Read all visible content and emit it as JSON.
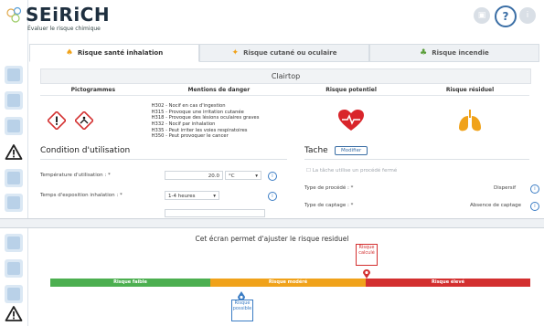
{
  "header": {
    "brand": "SEiRiCH",
    "tagline": "Évaluer le risque chimique",
    "help_label": "?",
    "colors": {
      "brand": "#1e2f3f",
      "accent": "#3a6ea5"
    }
  },
  "tabs": [
    {
      "label": "Risque santé inhalation",
      "icon": "lungs-icon",
      "active": true
    },
    {
      "label": "Risque cutané ou oculaire",
      "icon": "drops-icon",
      "active": false
    },
    {
      "label": "Risque incendie",
      "icon": "plant-icon",
      "active": false
    }
  ],
  "product": {
    "name": "Clairtop"
  },
  "table": {
    "headers": [
      "Pictogrammes",
      "Mentions de danger",
      "Risque potentiel",
      "Risque résiduel"
    ],
    "pictograms": [
      "exclamation-pictogram",
      "health-hazard-pictogram"
    ],
    "hazard_statements": [
      "H302 - Nocif en cas d'ingestion",
      "H315 - Provoque une irritation cutanée",
      "H318 - Provoque des lésions oculaires graves",
      "H332 - Nocif par inhalation",
      "H335 - Peut irriter les voies respiratoires",
      "H350 - Peut provoquer le cancer"
    ],
    "potential_risk_icon": "heart-icon",
    "residual_risk_icon": "lungs-icon"
  },
  "conditions": {
    "title": "Condition d'utilisation",
    "temperature_label": "Température d'utilisation : *",
    "temperature_value": "20.0",
    "temperature_unit": "°C",
    "exposure_label": "Temps d'exposition inhalation : *",
    "exposure_value": "1-4 heures"
  },
  "task": {
    "title": "Tache",
    "modify_label": "Modifier",
    "checkbox_label": "La tâche utilise un procédé fermé",
    "process_type_label": "Type de procédé : *",
    "process_type_value": "Dispersif",
    "capture_type_label": "Type de captage : *",
    "capture_type_value": "Absence de captage"
  },
  "adjust": {
    "title": "Cet écran permet d'ajuster le risque residuel",
    "bands": [
      "Risque faible",
      "Risque modéré",
      "Risque élevé"
    ],
    "colors": {
      "low": "#4caf50",
      "moderate": "#f0a21a",
      "high": "#d32f2f"
    },
    "calculated_marker": [
      "Risque",
      "calculé"
    ],
    "possible_marker": [
      "Risque",
      "possible"
    ]
  }
}
